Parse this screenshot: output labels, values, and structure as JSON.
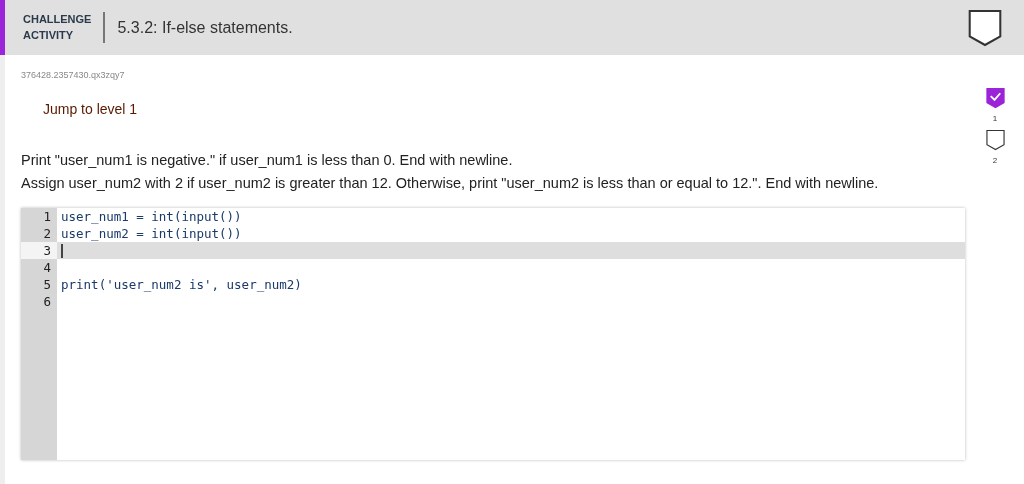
{
  "header": {
    "label_lines": [
      "CHALLENGE",
      "ACTIVITY"
    ],
    "title": "5.3.2: If-else statements.",
    "completed": false
  },
  "activity_id": "376428.2357430.qx3zqy7",
  "jump_link": "Jump to level 1",
  "instructions": [
    "Print \"user_num1 is negative.\" if user_num1 is less than 0. End with newline.",
    "Assign user_num2 with 2 if user_num2 is greater than 12. Otherwise, print \"user_num2 is less than or equal to 12.\". End with newline."
  ],
  "editor": {
    "lines": [
      {
        "number": "1",
        "code": "user_num1 = int(input())",
        "active": false
      },
      {
        "number": "2",
        "code": "user_num2 = int(input())",
        "active": false
      },
      {
        "number": "3",
        "active": true
      },
      {
        "number": "4",
        "active": false
      },
      {
        "number": "5",
        "code": "print('user_num2 is', user_num2)",
        "active": false
      },
      {
        "number": "6",
        "active": false
      }
    ]
  },
  "levels": [
    {
      "number": "1",
      "completed": true
    },
    {
      "number": "2",
      "completed": false
    }
  ]
}
